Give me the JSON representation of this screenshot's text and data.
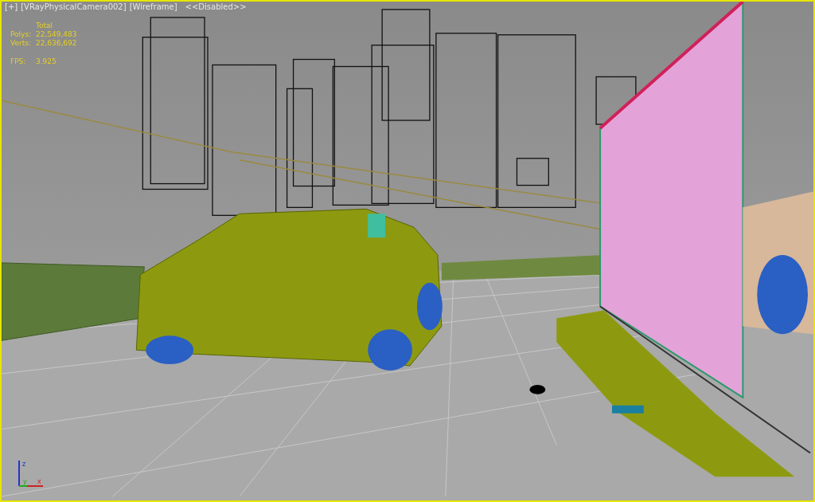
{
  "viewport": {
    "labels": [
      "[+]",
      "[VRayPhysicalCamera002]",
      "[Wireframe]",
      "<<Disabled>>"
    ],
    "stats": {
      "header": "Total",
      "groups": [
        [
          {
            "label": "Polys:",
            "value": "22,549,483"
          },
          {
            "label": "Verts:",
            "value": "22,636,692"
          }
        ],
        [
          {
            "label": "FPS:",
            "value": "3.925"
          }
        ]
      ]
    },
    "axis": {
      "z": "z",
      "y": "y",
      "x": "x"
    }
  }
}
